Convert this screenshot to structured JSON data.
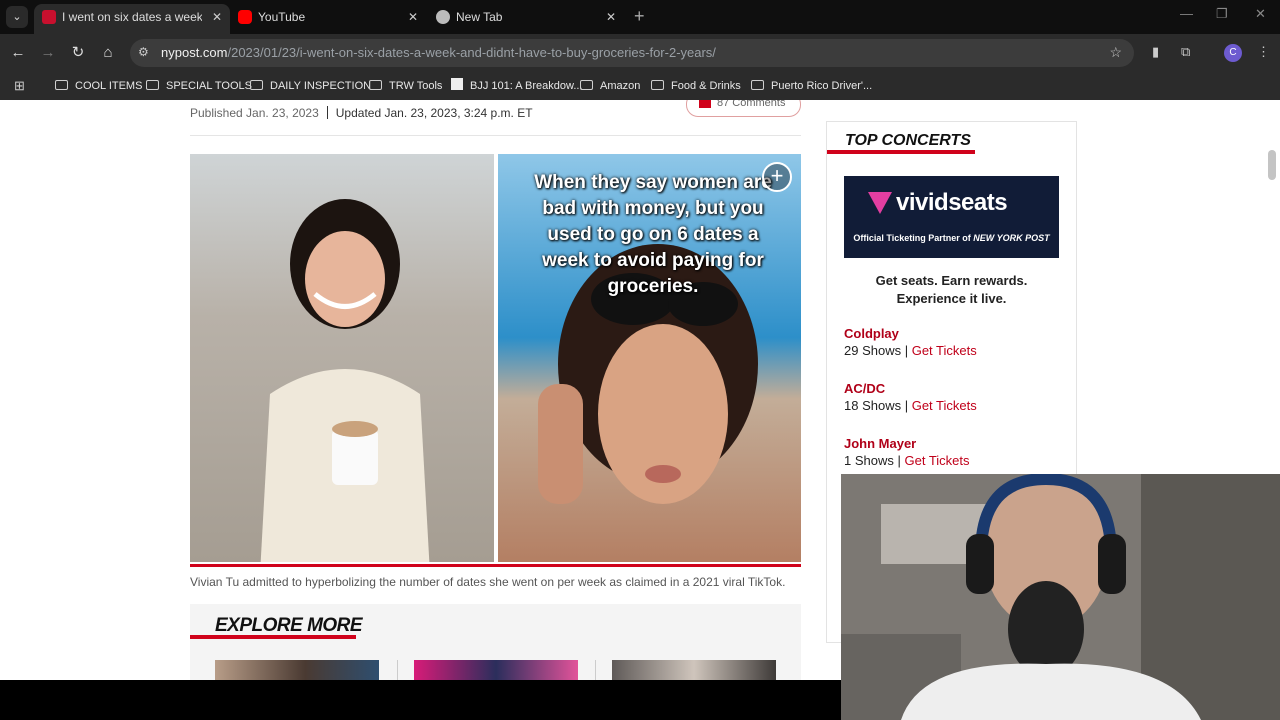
{
  "tabs": [
    {
      "title": "I went on six dates a week — ar",
      "active": true
    },
    {
      "title": "YouTube",
      "active": false
    },
    {
      "title": "New Tab",
      "active": false
    }
  ],
  "toolbar": {
    "url_host": "nypost.com",
    "url_path": "/2023/01/23/i-went-on-six-dates-a-week-and-didnt-have-to-buy-groceries-for-2-years/",
    "profile_initial": "C"
  },
  "bookmarks": [
    "COOL ITEMS",
    "SPECIAL TOOLS",
    "DAILY INSPECTION",
    "TRW Tools",
    "BJJ 101: A Breakdow...",
    "Amazon",
    "Food & Drinks",
    "Puerto Rico Driver'..."
  ],
  "article": {
    "published": "Published Jan. 23, 2023",
    "updated": "Updated Jan. 23, 2023, 3:24 p.m. ET",
    "comments": "87 Comments",
    "image_overlay_text": "When they say women are bad with money, but you used to go on 6 dates a week to avoid paying for groceries.",
    "caption": "Vivian Tu admitted to hyperbolizing the number of dates she went on per week as claimed in a 2021 viral TikTok.",
    "explore_heading": "EXPLORE MORE"
  },
  "sidebar": {
    "heading": "TOP CONCERTS",
    "sponsor_logo": "vividseats",
    "sponsor_sub": "Official Ticketing Partner of",
    "sponsor_sub_brand": "NEW YORK POST",
    "tagline": "Get seats. Earn rewards. Experience it live.",
    "concerts": [
      {
        "artist": "Coldplay",
        "shows": "29 Shows",
        "link": "Get Tickets"
      },
      {
        "artist": "AC/DC",
        "shows": "18 Shows",
        "link": "Get Tickets"
      },
      {
        "artist": "John Mayer",
        "shows": "1 Shows",
        "link": "Get Tickets"
      }
    ]
  },
  "colors": {
    "accent": "#d0021b",
    "vivid_bg": "#111c37"
  }
}
